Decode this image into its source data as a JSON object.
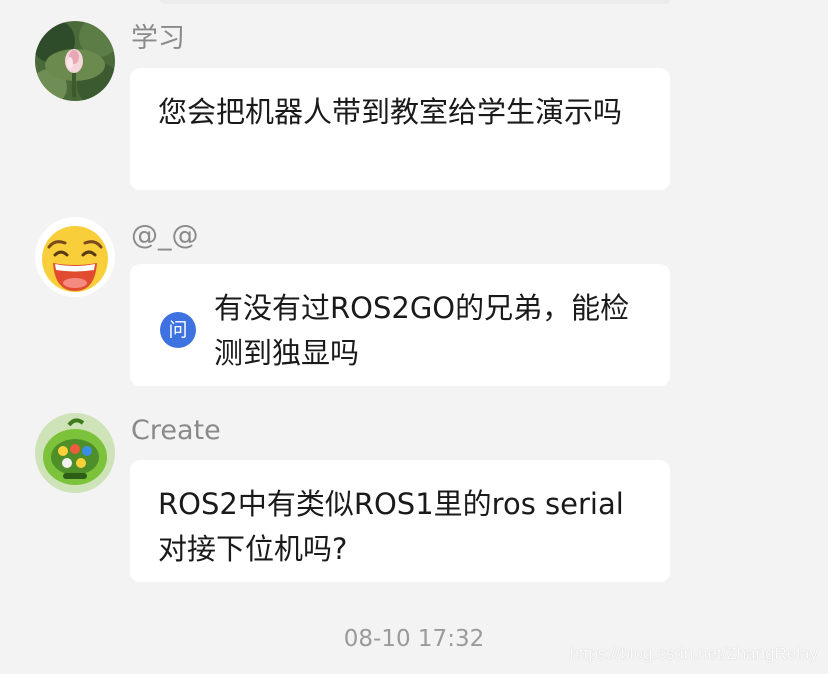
{
  "messages": [
    {
      "sender": "学习",
      "text": "您会把机器人带到教室给学生演示吗",
      "avatar_icon": "lotus-avatar-icon"
    },
    {
      "sender": "@_@",
      "badge": "问",
      "text": "有没有过ROS2GO的兄弟，能检测到独显吗",
      "avatar_icon": "laughing-face-avatar-icon"
    },
    {
      "sender": "Create",
      "text": "ROS2中有类似ROS1里的ros serial 对接下位机吗?",
      "avatar_icon": "toy-avatar-icon"
    }
  ],
  "timestamp": "08-10 17:32",
  "watermark": "https://blog.csdn.net/ZhangRelay",
  "colors": {
    "background": "#f3f3f3",
    "bubble": "#ffffff",
    "badge": "#3d72e0",
    "sender": "#8a8a8a"
  }
}
